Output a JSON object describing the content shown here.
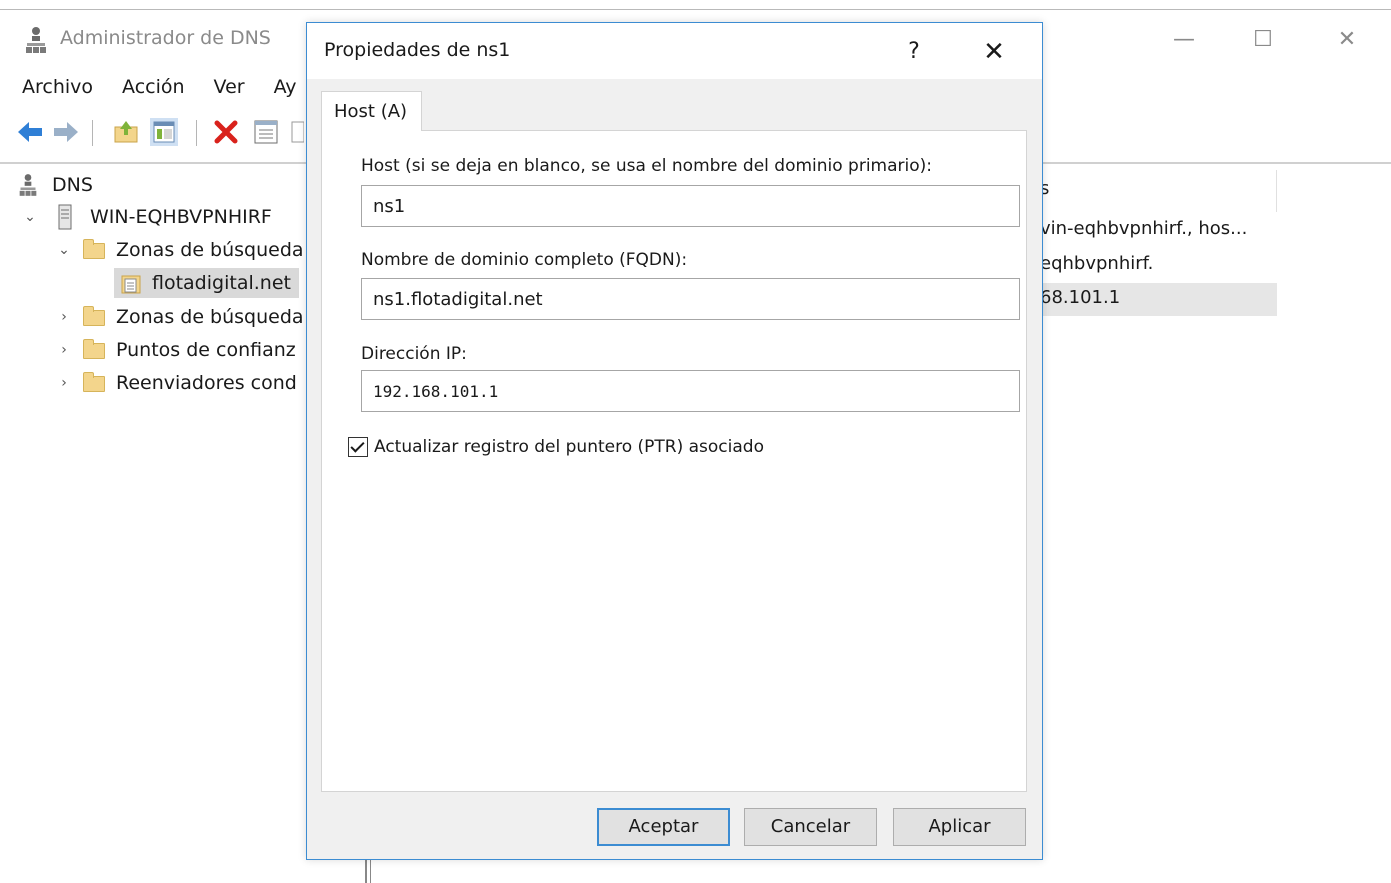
{
  "app": {
    "title": "Administrador de DNS",
    "icon": "dns-manager-icon",
    "window_controls": {
      "minimize": "—",
      "maximize": "☐",
      "close": "✕"
    }
  },
  "menu": [
    "Archivo",
    "Acción",
    "Ver",
    "Ay"
  ],
  "toolbar": {
    "buttons": [
      "back-arrow-icon",
      "forward-arrow-icon",
      "up-folder-icon",
      "show-hide-tree-icon",
      "delete-icon",
      "properties-icon",
      "export-list-icon"
    ]
  },
  "tree": {
    "root": "DNS",
    "server": "WIN-EQHBVPNHIRF",
    "items": [
      {
        "label": "Zonas de búsqueda",
        "expanded": true
      },
      {
        "label": "flotadigital.net",
        "selected": true
      },
      {
        "label": "Zonas de búsqueda",
        "expanded": false
      },
      {
        "label": "Puntos de confianz",
        "expanded": false
      },
      {
        "label": "Reenviadores cond",
        "expanded": false
      }
    ]
  },
  "list_pane": {
    "header": "s",
    "rows": [
      "vin-eqhbvpnhirf., hos...",
      "eqhbvpnhirf.",
      "68.101.1"
    ]
  },
  "dialog": {
    "title": "Propiedades de ns1",
    "help": "?",
    "close": "✕",
    "tab": "Host (A)",
    "host_label": "Host (si se deja en blanco, se usa el nombre del dominio primario):",
    "host_value": "ns1",
    "fqdn_label": "Nombre de dominio completo (FQDN):",
    "fqdn_value": "ns1.flotadigital.net",
    "ip_label": "Dirección IP:",
    "ip_value": "192.168.101.1",
    "ptr_checkbox_label": "Actualizar registro del puntero (PTR) asociado",
    "ptr_checked": true,
    "buttons": {
      "ok": "Aceptar",
      "cancel": "Cancelar",
      "apply": "Aplicar"
    }
  },
  "colors": {
    "dialog_border": "#3c8cd2",
    "folder": "#f3d58c",
    "delete_red": "#d9221c",
    "nav_blue": "#2f7fd6",
    "nav_green": "#7fb33a"
  }
}
